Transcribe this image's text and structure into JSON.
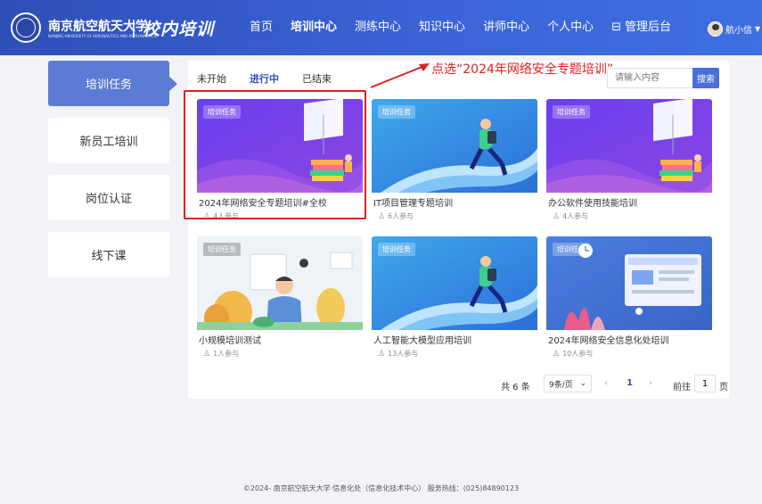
{
  "header": {
    "university_name": "南京航空航天大学",
    "university_en": "NANJING UNIVERSITY OF AERONAUTICS AND ASTRONAUTICS",
    "brand": "校内培训",
    "nav": [
      "首页",
      "培训中心",
      "测练中心",
      "知识中心",
      "讲师中心",
      "个人中心"
    ],
    "admin_label": "管理后台",
    "user_name": "航小信"
  },
  "sidebar": {
    "items": [
      "培训任务",
      "新员工培训",
      "岗位认证",
      "线下课"
    ]
  },
  "tabs": [
    "未开始",
    "进行中",
    "已结束"
  ],
  "search": {
    "placeholder": "请输入内容",
    "button": "搜索"
  },
  "cards": [
    {
      "badge": "培训任务",
      "title": "2024年网络安全专题培训#全校",
      "participants": "4人参与"
    },
    {
      "badge": "培训任务",
      "title": "IT项目管理专题培训",
      "participants": "6人参与"
    },
    {
      "badge": "培训任务",
      "title": "办公软件使用技能培训",
      "participants": "4人参与"
    },
    {
      "badge": "培训任务",
      "title": "小规模培训测试",
      "participants": "1人参与"
    },
    {
      "badge": "培训任务",
      "title": "人工智能大模型应用培训",
      "participants": "13人参与"
    },
    {
      "badge": "培训任务",
      "title": "2024年网络安全信息化处培训",
      "participants": "10人参与"
    }
  ],
  "pagination": {
    "total": "共 6 条",
    "page_size": "9条/页",
    "current": "1",
    "goto_prefix": "前往",
    "goto_value": "1",
    "goto_suffix": "页"
  },
  "footer": "©2024- 南京航空航天大学·信息化处（信息化技术中心） 服务热线：(025)84890123",
  "annotation": "点选“2024年网络安全专题培训”",
  "colors": {
    "header": "#3a63d6",
    "accent": "#2d4fb8",
    "sidebar_active": "#5b7bd5",
    "annotation": "#e02020"
  }
}
